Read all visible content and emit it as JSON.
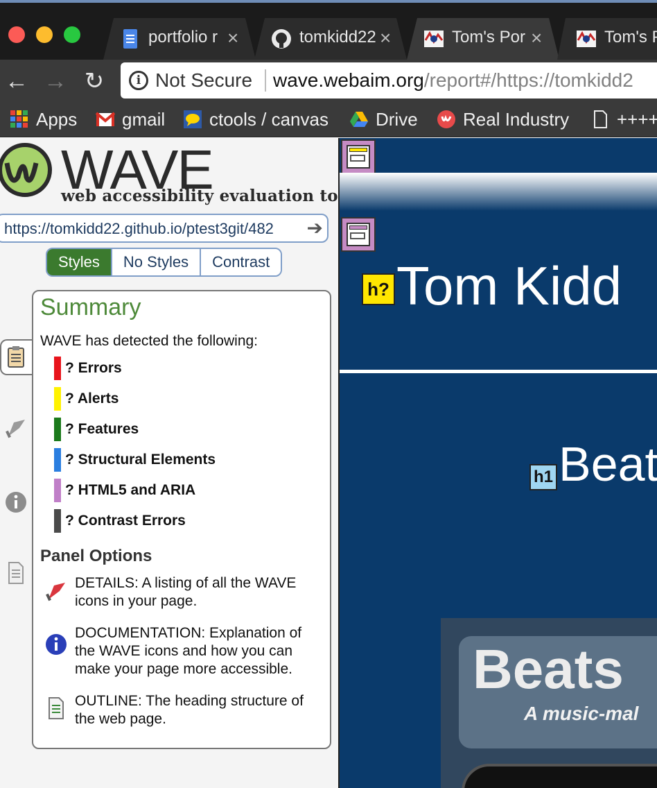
{
  "browser": {
    "tabs": [
      {
        "title": "portfolio r",
        "icon": "google-docs-icon",
        "active": false
      },
      {
        "title": "tomkidd22",
        "icon": "github-icon",
        "active": false
      },
      {
        "title": "Tom's Por",
        "icon": "portfolio-favicon-icon",
        "active": true
      },
      {
        "title": "Tom's P",
        "icon": "portfolio-favicon-icon",
        "active": false
      }
    ],
    "address": {
      "security_label": "Not Secure",
      "host": "wave.webaim.org",
      "path": "/report#/https://tomkidd2"
    },
    "bookmarks": [
      {
        "label": "Apps",
        "icon": "apps-grid-icon"
      },
      {
        "label": "gmail",
        "icon": "gmail-icon"
      },
      {
        "label": "ctools / canvas",
        "icon": "ctools-icon"
      },
      {
        "label": "Drive",
        "icon": "drive-icon"
      },
      {
        "label": "Real Industry",
        "icon": "real-industry-icon"
      },
      {
        "label": "++++",
        "icon": "page-icon"
      }
    ]
  },
  "wave": {
    "logo_word": "WAVE",
    "tagline": "web accessibility evaluation tool",
    "url_value": "https://tomkidd22.github.io/ptest3git/482",
    "view_modes": [
      "Styles",
      "No Styles",
      "Contrast"
    ],
    "active_view": "Styles",
    "summary": {
      "title": "Summary",
      "intro": "WAVE has detected the following:",
      "counts": [
        {
          "label": "? Errors",
          "color": "#e8141b"
        },
        {
          "label": "? Alerts",
          "color": "#fff200"
        },
        {
          "label": "? Features",
          "color": "#1b7a1b"
        },
        {
          "label": "? Structural Elements",
          "color": "#2a7ee0"
        },
        {
          "label": "? HTML5 and ARIA",
          "color": "#c07fc8"
        },
        {
          "label": "? Contrast Errors",
          "color": "#4a4a4a"
        }
      ],
      "panel_options_title": "Panel Options",
      "options": [
        {
          "text": "DETAILS: A listing of all the WAVE icons in your page.",
          "icon": "flag-icon"
        },
        {
          "text": "DOCUMENTATION: Explanation of the WAVE icons and how you can make your page more accessible.",
          "icon": "info-icon"
        },
        {
          "text": "OUTLINE: The heading structure of the web page.",
          "icon": "outline-doc-icon"
        }
      ]
    }
  },
  "page": {
    "name_heading": "Tom Kidd",
    "h2_tag": "h?",
    "h1_tag": "h1",
    "section_heading": "Beat",
    "hero_title": "Beats",
    "hero_subtitle": "A music-mal"
  }
}
